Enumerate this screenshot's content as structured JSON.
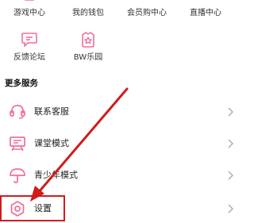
{
  "top_grid": [
    {
      "label": "游戏中心",
      "icon": "gamepad-icon"
    },
    {
      "label": "我的钱包",
      "icon": "wallet-icon"
    },
    {
      "label": "会员购中心",
      "icon": "shopping-bag-icon"
    },
    {
      "label": "直播中心",
      "icon": "live-tv-icon"
    }
  ],
  "second_grid": [
    {
      "label": "反馈论坛",
      "icon": "feedback-chat-icon"
    },
    {
      "label": "BW乐园",
      "icon": "star-badge-icon"
    }
  ],
  "more_services": {
    "title": "更多服务",
    "items": [
      {
        "label": "联系客服",
        "icon": "headset-icon"
      },
      {
        "label": "课堂模式",
        "icon": "classroom-board-icon"
      },
      {
        "label": "青少年模式",
        "icon": "umbrella-icon"
      },
      {
        "label": "设置",
        "icon": "settings-gear-icon"
      }
    ]
  },
  "colors": {
    "accent_pink": "#f06f98",
    "annotation_red": "#d01c1c"
  }
}
